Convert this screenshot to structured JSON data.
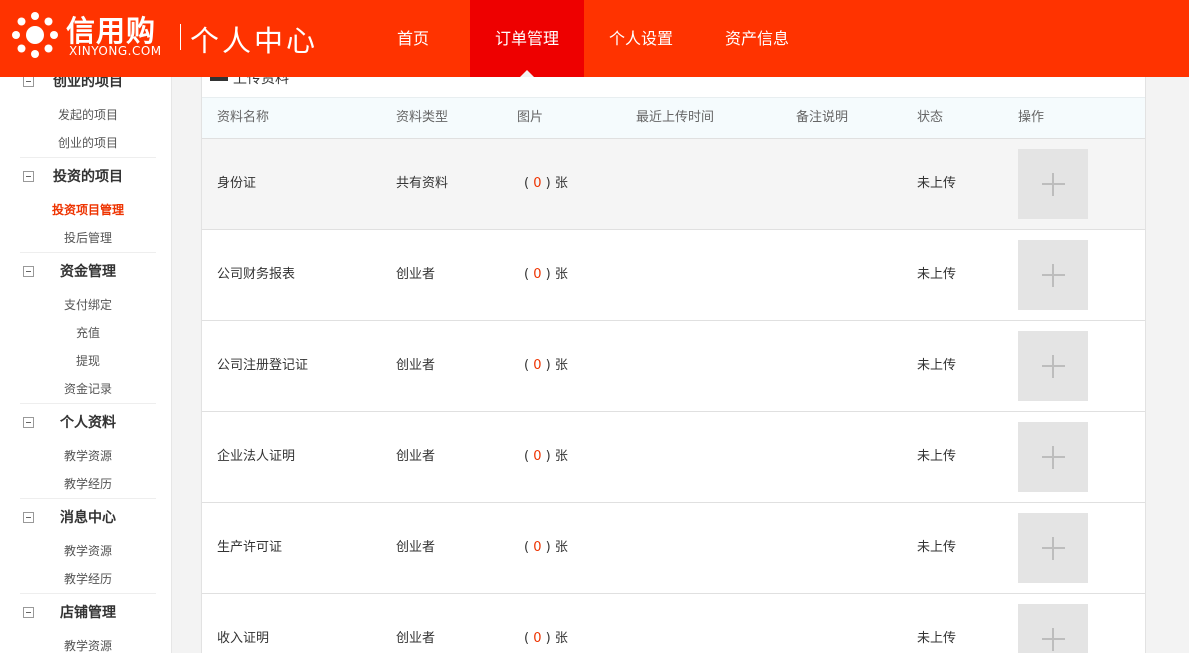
{
  "header": {
    "brand_cn": "信用购",
    "brand_en": "XINYONG.COM",
    "title": "个人中心",
    "nav": [
      {
        "label": "首页",
        "active": false
      },
      {
        "label": "订单管理",
        "active": true
      },
      {
        "label": "个人设置",
        "active": false
      },
      {
        "label": "资产信息",
        "active": false
      }
    ]
  },
  "sidebar": {
    "groups": [
      {
        "title": "创业的项目",
        "items": [
          {
            "label": "发起的项目",
            "active": false
          },
          {
            "label": "创业的项目",
            "active": false
          }
        ]
      },
      {
        "title": "投资的项目",
        "items": [
          {
            "label": "投资项目管理",
            "active": true
          },
          {
            "label": "投后管理",
            "active": false
          }
        ]
      },
      {
        "title": "资金管理",
        "items": [
          {
            "label": "支付绑定",
            "active": false
          },
          {
            "label": "充值",
            "active": false
          },
          {
            "label": "提现",
            "active": false
          },
          {
            "label": "资金记录",
            "active": false
          }
        ]
      },
      {
        "title": "个人资料",
        "items": [
          {
            "label": "教学资源",
            "active": false
          },
          {
            "label": "教学经历",
            "active": false
          }
        ]
      },
      {
        "title": "消息中心",
        "items": [
          {
            "label": "教学资源",
            "active": false
          },
          {
            "label": "教学经历",
            "active": false
          }
        ]
      },
      {
        "title": "店铺管理",
        "items": [
          {
            "label": "教学资源",
            "active": false
          }
        ]
      }
    ]
  },
  "panel": {
    "title": "上传资料",
    "columns": [
      "资料名称",
      "资料类型",
      "图片",
      "最近上传时间",
      "备注说明",
      "状态",
      "操作"
    ],
    "rows": [
      {
        "name": "身份证",
        "type": "共有资料",
        "count": "0",
        "unit": "张",
        "time": "",
        "note": "",
        "status": "未上传"
      },
      {
        "name": "公司财务报表",
        "type": "创业者",
        "count": "0",
        "unit": "张",
        "time": "",
        "note": "",
        "status": "未上传"
      },
      {
        "name": "公司注册登记证",
        "type": "创业者",
        "count": "0",
        "unit": "张",
        "time": "",
        "note": "",
        "status": "未上传"
      },
      {
        "name": "企业法人证明",
        "type": "创业者",
        "count": "0",
        "unit": "张",
        "time": "",
        "note": "",
        "status": "未上传"
      },
      {
        "name": "生产许可证",
        "type": "创业者",
        "count": "0",
        "unit": "张",
        "time": "",
        "note": "",
        "status": "未上传"
      },
      {
        "name": "收入证明",
        "type": "创业者",
        "count": "0",
        "unit": "张",
        "time": "",
        "note": "",
        "status": "未上传"
      }
    ]
  },
  "colors": {
    "brand": "#ff3300",
    "nav_active": "#ee0000",
    "highlight": "#ee3300"
  }
}
